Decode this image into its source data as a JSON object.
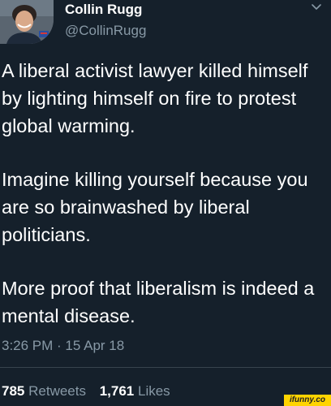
{
  "author": {
    "name": "Collin Rugg",
    "handle": "@CollinRugg"
  },
  "tweet": {
    "paragraphs": [
      "A liberal activist lawyer killed himself by lighting himself on fire to protest global warming.",
      "Imagine killing yourself because you are so brainwashed by liberal politicians.",
      "More proof that liberalism is indeed a mental disease."
    ],
    "timestamp": "3:26 PM · 15 Apr 18"
  },
  "stats": {
    "retweets_count": "785",
    "retweets_label": "Retweets",
    "likes_count": "1,761",
    "likes_label": "Likes"
  },
  "watermark": "ifunny.co",
  "colors": {
    "background": "#15202b",
    "text": "#ffffff",
    "secondary_text": "#8899a6",
    "divider": "#38444d",
    "watermark_bg": "#ffd400"
  },
  "icons": {
    "menu": "chevron-down-icon"
  }
}
